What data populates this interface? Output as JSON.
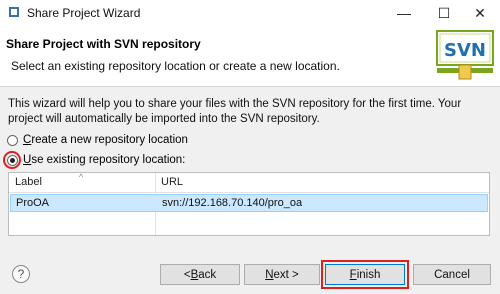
{
  "window": {
    "title": "Share Project Wizard",
    "minimize_glyph": "—",
    "maximize_glyph": "☐",
    "close_glyph": "✕"
  },
  "header": {
    "title": "Share Project with SVN repository",
    "subtitle": "Select an existing repository location or create a new location.",
    "logo_text": "SVN"
  },
  "content": {
    "description": "This wizard will help you to share your files with the SVN repository for the first time. Your project will automatically be imported into the SVN repository.",
    "options": [
      {
        "mnemonic": "C",
        "rest": "reate a new repository location",
        "checked": false
      },
      {
        "mnemonic": "U",
        "rest": "se existing repository location:",
        "checked": true
      }
    ],
    "table": {
      "columns": [
        "Label",
        "URL"
      ],
      "rows": [
        {
          "label": "ProOA",
          "url": "svn://192.168.70.140/pro_oa",
          "selected": true
        }
      ]
    }
  },
  "footer": {
    "help_glyph": "?",
    "back": {
      "prefix": "< ",
      "mnemonic": "B",
      "rest": "ack"
    },
    "next": {
      "mnemonic": "N",
      "rest": "ext >"
    },
    "finish": {
      "mnemonic": "F",
      "rest": "inish"
    },
    "cancel": "Cancel"
  },
  "colors": {
    "highlight_red": "#e0201e",
    "selection_blue": "#cce8ff",
    "svn_green": "#7aa61e",
    "svn_blue": "#1f6fb3"
  },
  "icons": {
    "app": "wizard-icon",
    "help": "help-icon",
    "logo": "svn-logo"
  }
}
